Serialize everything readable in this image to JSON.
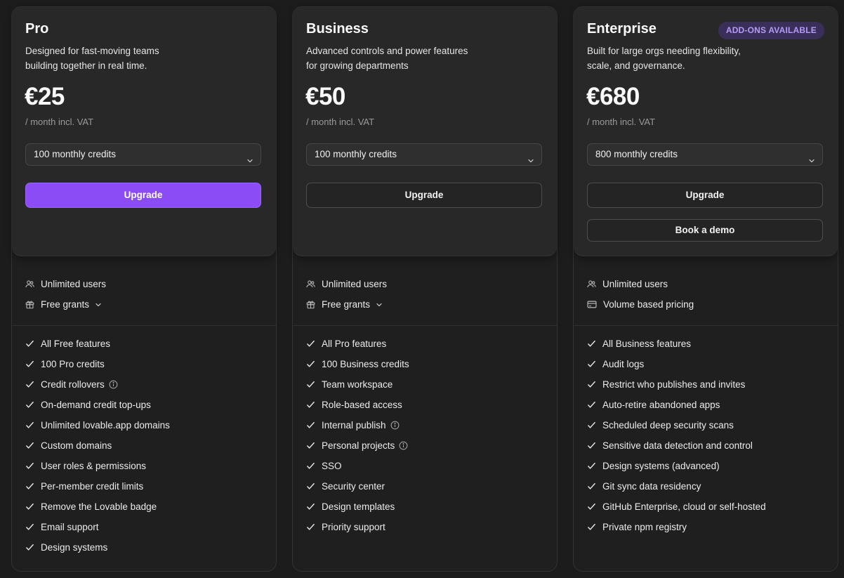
{
  "plans": [
    {
      "name": "Pro",
      "badge": "",
      "description": "Designed for fast-moving teams building together in real time.",
      "price": "€25",
      "period": "/ month incl. VAT",
      "credits": "100 monthly credits",
      "upgrade_label": "Upgrade",
      "upgrade_primary": true,
      "demo_label": "",
      "meta": [
        {
          "icon": "users-icon",
          "label": "Unlimited users",
          "chevron": false
        },
        {
          "icon": "gift-icon",
          "label": "Free grants",
          "chevron": true
        }
      ],
      "features": [
        {
          "label": "All Free features",
          "info": false
        },
        {
          "label": "100 Pro credits",
          "info": false
        },
        {
          "label": "Credit rollovers",
          "info": true
        },
        {
          "label": "On-demand credit top-ups",
          "info": false
        },
        {
          "label": "Unlimited lovable.app domains",
          "info": false
        },
        {
          "label": "Custom domains",
          "info": false
        },
        {
          "label": "User roles & permissions",
          "info": false
        },
        {
          "label": "Per-member credit limits",
          "info": false
        },
        {
          "label": "Remove the Lovable badge",
          "info": false
        },
        {
          "label": "Email support",
          "info": false
        },
        {
          "label": "Design systems",
          "info": false
        }
      ]
    },
    {
      "name": "Business",
      "badge": "",
      "description": "Advanced controls and power features for growing departments",
      "price": "€50",
      "period": "/ month incl. VAT",
      "credits": "100 monthly credits",
      "upgrade_label": "Upgrade",
      "upgrade_primary": false,
      "demo_label": "",
      "meta": [
        {
          "icon": "users-icon",
          "label": "Unlimited users",
          "chevron": false
        },
        {
          "icon": "gift-icon",
          "label": "Free grants",
          "chevron": true
        }
      ],
      "features": [
        {
          "label": "All Pro features",
          "info": false
        },
        {
          "label": "100 Business credits",
          "info": false
        },
        {
          "label": "Team workspace",
          "info": false
        },
        {
          "label": "Role-based access",
          "info": false
        },
        {
          "label": "Internal publish",
          "info": true
        },
        {
          "label": "Personal projects",
          "info": true
        },
        {
          "label": "SSO",
          "info": false
        },
        {
          "label": "Security center",
          "info": false
        },
        {
          "label": "Design templates",
          "info": false
        },
        {
          "label": "Priority support",
          "info": false
        }
      ]
    },
    {
      "name": "Enterprise",
      "badge": "ADD-ONS AVAILABLE",
      "description": "Built for large orgs needing flexibility, scale, and governance.",
      "price": "€680",
      "period": "/ month incl. VAT",
      "credits": "800 monthly credits",
      "upgrade_label": "Upgrade",
      "upgrade_primary": false,
      "demo_label": "Book a demo",
      "meta": [
        {
          "icon": "users-icon",
          "label": "Unlimited users",
          "chevron": false
        },
        {
          "icon": "card-icon",
          "label": "Volume based pricing",
          "chevron": false
        }
      ],
      "features": [
        {
          "label": "All Business features",
          "info": false
        },
        {
          "label": "Audit logs",
          "info": false
        },
        {
          "label": "Restrict who publishes and invites",
          "info": false
        },
        {
          "label": "Auto-retire abandoned apps",
          "info": false
        },
        {
          "label": "Scheduled deep security scans",
          "info": false
        },
        {
          "label": "Sensitive data detection and control",
          "info": false
        },
        {
          "label": "Design systems (advanced)",
          "info": false
        },
        {
          "label": "Git sync data residency",
          "info": false
        },
        {
          "label": "GitHub Enterprise, cloud or self-hosted",
          "info": false
        },
        {
          "label": "Private npm registry",
          "info": false
        }
      ]
    }
  ],
  "colors": {
    "accent": "#8b4cf6",
    "badge_bg": "#3a2f5a",
    "badge_text": "#b59af7",
    "page_bg": "#1c1c1c",
    "card_top_bg": "#282828"
  }
}
